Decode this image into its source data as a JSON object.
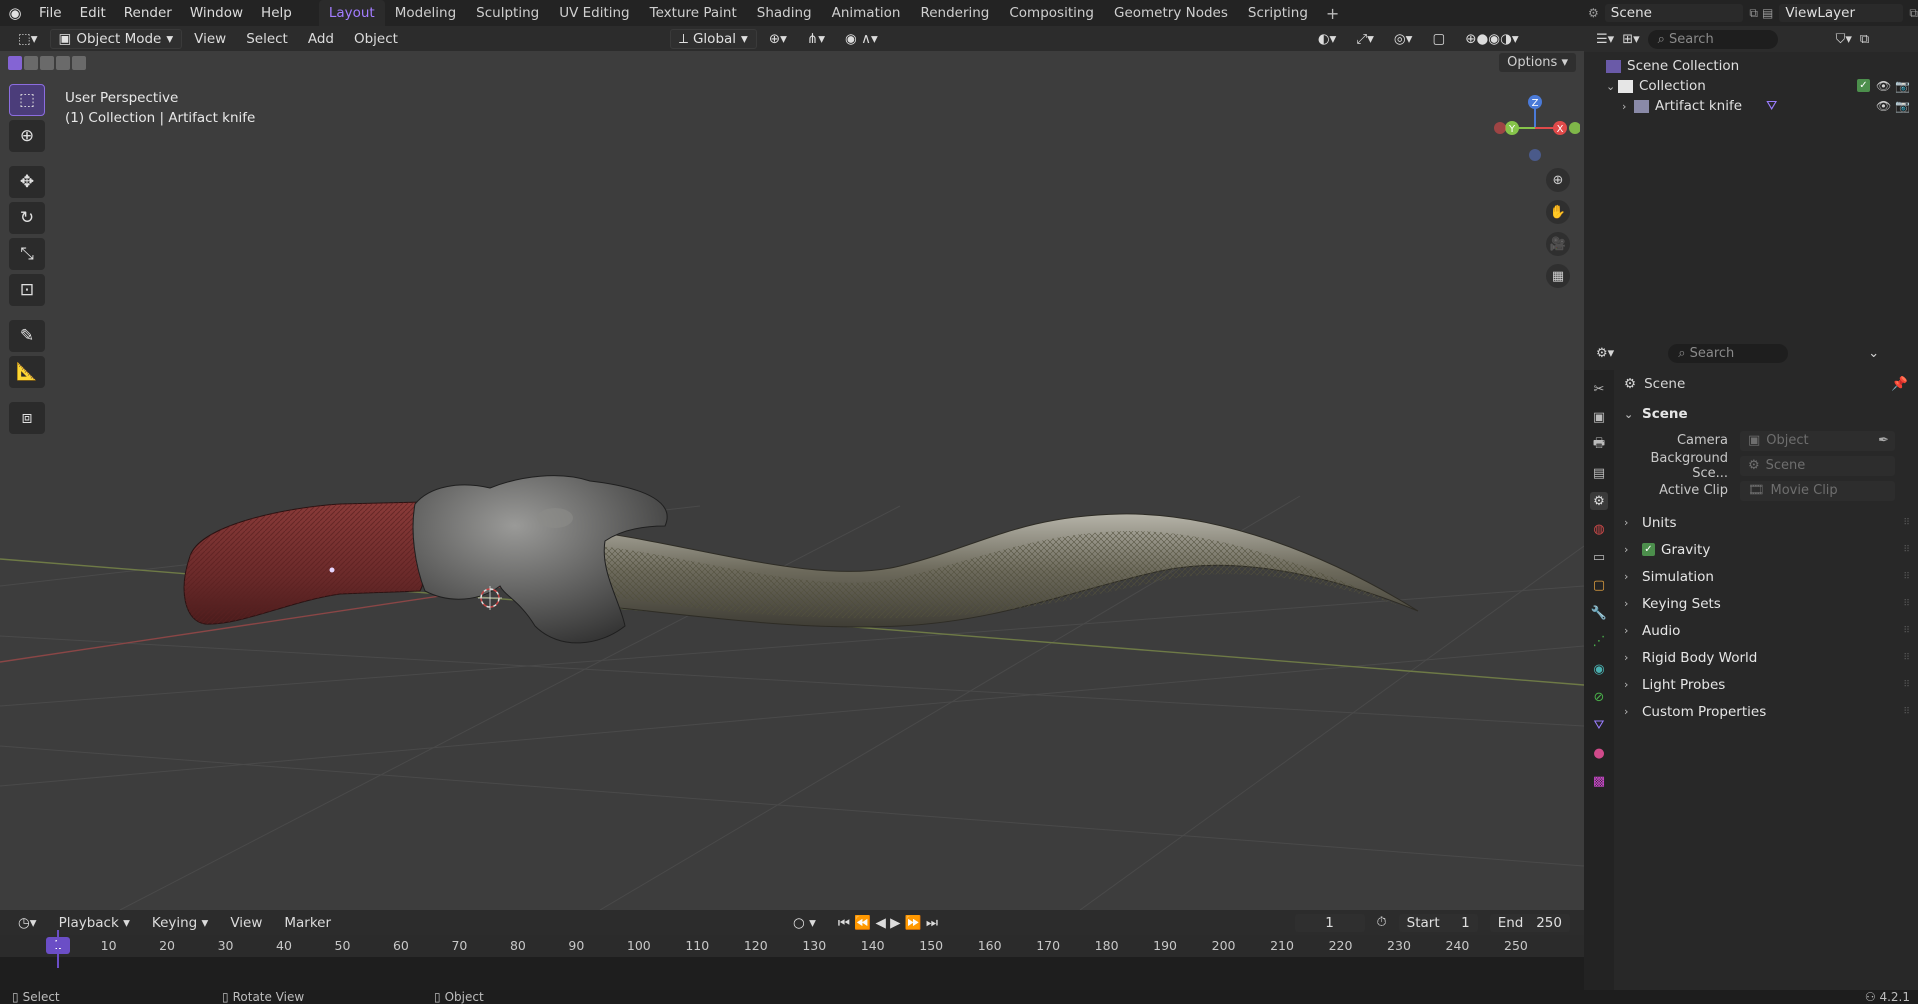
{
  "topbar": {
    "menus": [
      "File",
      "Edit",
      "Render",
      "Window",
      "Help"
    ],
    "workspaces": [
      "Layout",
      "Modeling",
      "Sculpting",
      "UV Editing",
      "Texture Paint",
      "Shading",
      "Animation",
      "Rendering",
      "Compositing",
      "Geometry Nodes",
      "Scripting"
    ],
    "active_workspace": "Layout",
    "scene": "Scene",
    "view_layer": "ViewLayer"
  },
  "viewport": {
    "mode": "Object Mode",
    "menus": [
      "View",
      "Select",
      "Add",
      "Object"
    ],
    "orientation": "Global",
    "options_label": "Options",
    "perspective_label": "User Perspective",
    "collection_label": "(1) Collection | Artifact knife",
    "gizmo_axes": [
      "Z",
      "Y",
      "X"
    ]
  },
  "timeline": {
    "menus": [
      "Playback",
      "Keying",
      "View",
      "Marker"
    ],
    "current_frame": "1",
    "start_label": "Start",
    "start": "1",
    "end_label": "End",
    "end": "250",
    "ticks": [
      "10",
      "20",
      "30",
      "40",
      "50",
      "60",
      "70",
      "80",
      "90",
      "100",
      "110",
      "120",
      "130",
      "140",
      "150",
      "160",
      "170",
      "180",
      "190",
      "200",
      "210",
      "220",
      "230",
      "240",
      "250"
    ],
    "playhead": "1"
  },
  "statusbar": {
    "select": "Select",
    "rotate": "Rotate View",
    "object": "Object",
    "version": "4.2.1"
  },
  "outliner": {
    "search_placeholder": "Search",
    "scene_collection": "Scene Collection",
    "collection": "Collection",
    "object": "Artifact knife"
  },
  "properties": {
    "search_placeholder": "Search",
    "context": "Scene",
    "panel_title": "Scene",
    "camera_label": "Camera",
    "camera_placeholder": "Object",
    "background_label": "Background Sce...",
    "background_placeholder": "Scene",
    "clip_label": "Active Clip",
    "clip_placeholder": "Movie Clip",
    "panels": [
      "Units",
      "Gravity",
      "Simulation",
      "Keying Sets",
      "Audio",
      "Rigid Body World",
      "Light Probes",
      "Custom Properties"
    ]
  },
  "colors": {
    "accent": "#8464d4",
    "viewport_bg": "#3d3d3d",
    "x_axis": "#e04a4a",
    "y_axis": "#86c44a",
    "z_axis": "#4a7ad8"
  }
}
